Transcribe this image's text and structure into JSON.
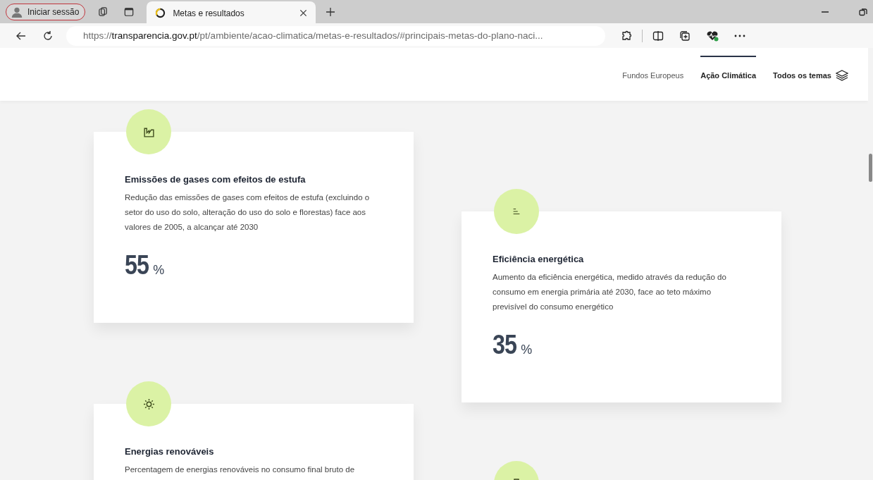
{
  "browser": {
    "profile_button": "Iniciar sessão",
    "tabs": [
      {
        "title": "Metas e resultados",
        "selected": true
      }
    ],
    "url": {
      "scheme": "https://",
      "host": "transparencia.gov.pt",
      "path": "/pt/ambiente/acao-climatica/metas-e-resultados/#principais-metas-do-plano-naci..."
    }
  },
  "nav": {
    "items": [
      {
        "label": "Fundos Europeus",
        "selected": false
      },
      {
        "label": "Ação Climática",
        "selected": true
      }
    ],
    "all_topics": "Todos os temas"
  },
  "columns": [
    {
      "cards": [
        {
          "kind": "chart",
          "title": "Emissões de gases com efeitos de estufa",
          "description": "Redução das emissões de gases com efeitos de estufa (excluindo o setor do uso do solo, alteração do uso do solo e florestas) face aos valores de 2005, a alcançar até 2030",
          "value": "55",
          "unit": "%"
        },
        {
          "kind": "sun",
          "title": "Energias renováveis",
          "description": "Percentagem de energias renováveis no consumo final bruto de"
        }
      ]
    },
    {
      "cards": [
        {
          "kind": "lines",
          "title": "Eficiência energética",
          "description": "Aumento da eficiência energética, medido através da redução do consumo em energia primária até 2030, face ao teto máximo previsível do consumo energético",
          "value": "35",
          "unit": "%"
        },
        {
          "kind": "device"
        }
      ]
    }
  ]
}
